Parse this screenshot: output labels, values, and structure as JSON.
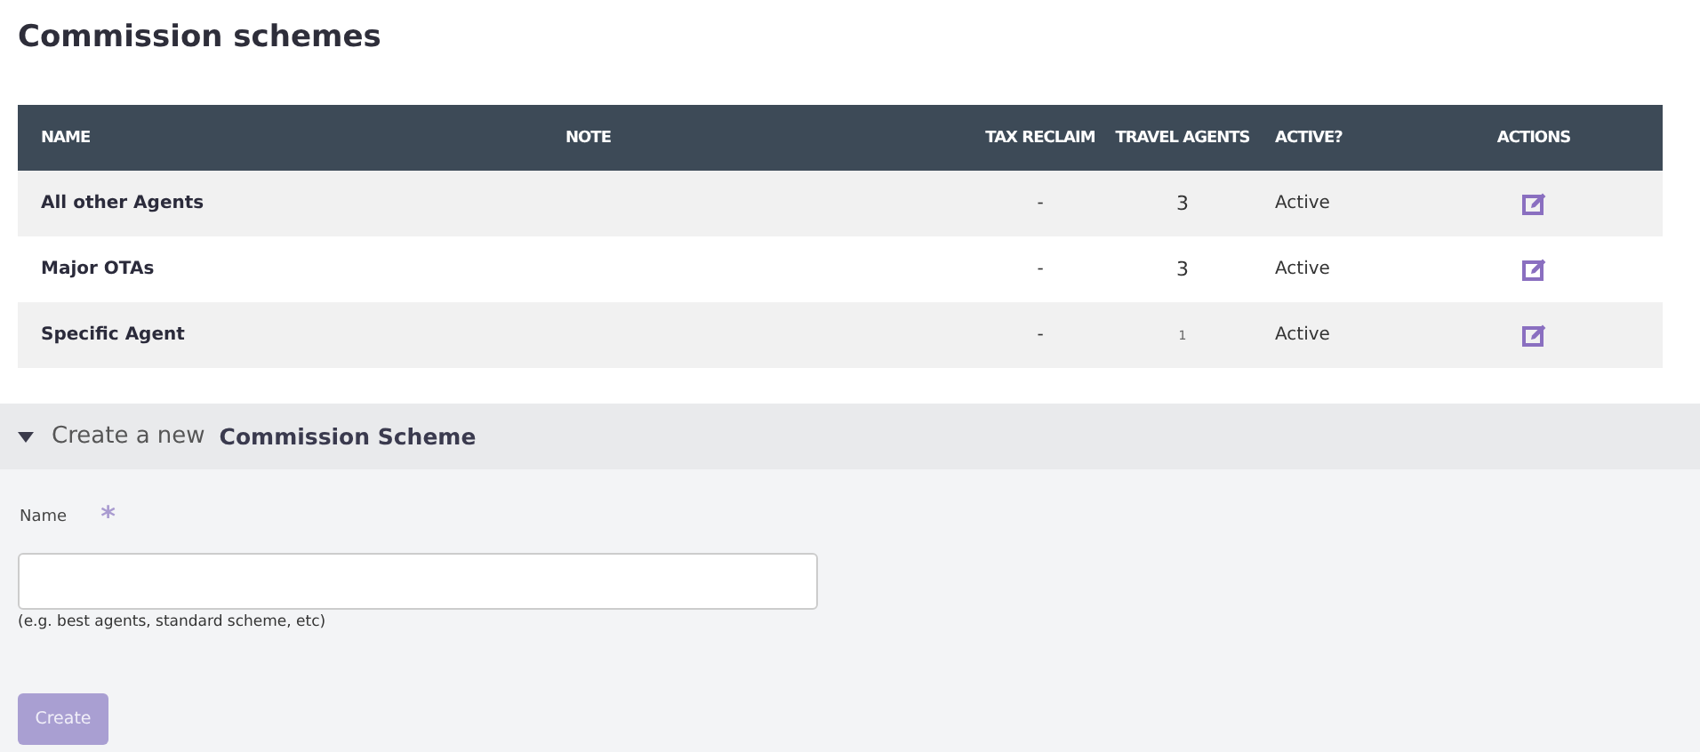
{
  "page_title": "Commission schemes",
  "table": {
    "columns": [
      "NAME",
      "NOTE",
      "TAX RECLAIM",
      "TRAVEL AGENTS",
      "ACTIVE?",
      "ACTIONS"
    ],
    "rows": [
      {
        "name": "All other Agents",
        "tax_reclaim": "-",
        "travel_agents": "3",
        "active": "Active"
      },
      {
        "name": "Major OTAs",
        "tax_reclaim": "-",
        "travel_agents": "3",
        "active": "Active"
      },
      {
        "name": "Specific Agent",
        "tax_reclaim": "-",
        "travel_agents": "1",
        "active": "Active"
      }
    ]
  },
  "create_section": {
    "expanded": true,
    "prefix": "Create a new",
    "title": "Commission Scheme",
    "field": {
      "label": "Name",
      "required_mark": "*",
      "hint": "(e.g. best agents, standard scheme, etc)"
    },
    "button": {
      "label": "Create",
      "disabled": true
    }
  }
}
